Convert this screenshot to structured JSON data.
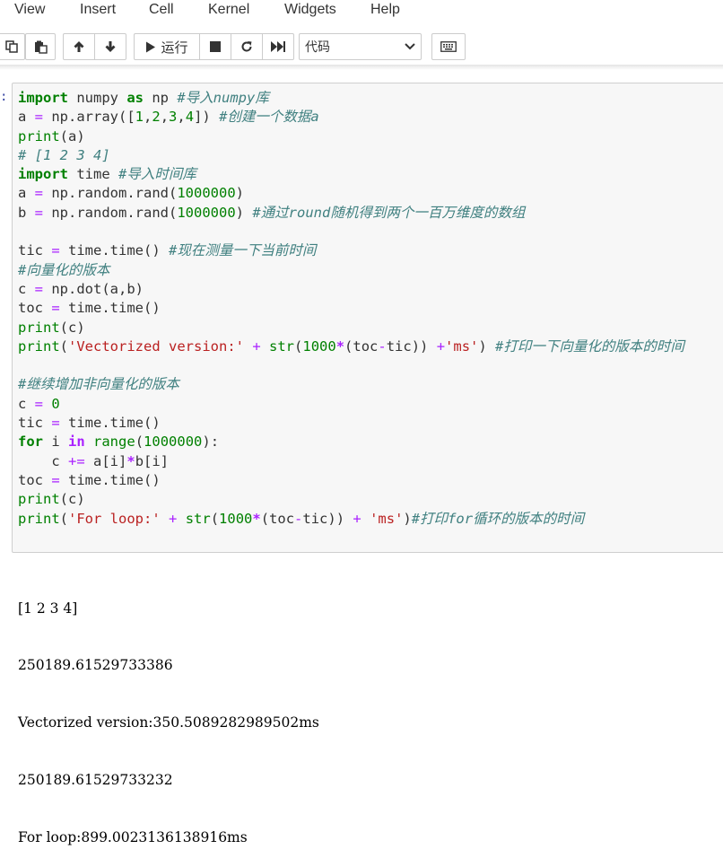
{
  "menubar": {
    "items": [
      "View",
      "Insert",
      "Cell",
      "Kernel",
      "Widgets",
      "Help"
    ]
  },
  "toolbar": {
    "run_label": "运行",
    "cell_type": "代码",
    "icons": [
      "copy-icon",
      "paste-icon",
      "move-up-icon",
      "move-down-icon",
      "run-icon",
      "stop-icon",
      "restart-icon",
      "fast-forward-icon",
      "keyboard-icon"
    ]
  },
  "cell": {
    "prompt": ":",
    "code_lines": [
      [
        [
          "kw",
          "import"
        ],
        [
          "t",
          " numpy "
        ],
        [
          "kw",
          "as"
        ],
        [
          "t",
          " np "
        ],
        [
          "cm",
          "#导入numpy库"
        ]
      ],
      [
        [
          "t",
          "a "
        ],
        [
          "op",
          "="
        ],
        [
          "t",
          " np.array(["
        ],
        [
          "num",
          "1"
        ],
        [
          "t",
          ","
        ],
        [
          "num",
          "2"
        ],
        [
          "t",
          ","
        ],
        [
          "num",
          "3"
        ],
        [
          "t",
          ","
        ],
        [
          "num",
          "4"
        ],
        [
          "t",
          "]) "
        ],
        [
          "cm",
          "#创建一个数据a"
        ]
      ],
      [
        [
          "bi",
          "print"
        ],
        [
          "t",
          "(a)"
        ]
      ],
      [
        [
          "cm",
          "# [1 2 3 4]"
        ]
      ],
      [
        [
          "kw",
          "import"
        ],
        [
          "t",
          " time "
        ],
        [
          "cm",
          "#导入时间库"
        ]
      ],
      [
        [
          "t",
          "a "
        ],
        [
          "op",
          "="
        ],
        [
          "t",
          " np.random.rand("
        ],
        [
          "num",
          "1000000"
        ],
        [
          "t",
          ")"
        ]
      ],
      [
        [
          "t",
          "b "
        ],
        [
          "op",
          "="
        ],
        [
          "t",
          " np.random.rand("
        ],
        [
          "num",
          "1000000"
        ],
        [
          "t",
          ") "
        ],
        [
          "cm",
          "#通过round随机得到两个一百万维度的数组"
        ]
      ],
      [],
      [
        [
          "t",
          "tic "
        ],
        [
          "op",
          "="
        ],
        [
          "t",
          " time.time() "
        ],
        [
          "cm",
          "#现在测量一下当前时间"
        ]
      ],
      [
        [
          "cm",
          "#向量化的版本"
        ]
      ],
      [
        [
          "t",
          "c "
        ],
        [
          "op",
          "="
        ],
        [
          "t",
          " np.dot(a,b)"
        ]
      ],
      [
        [
          "t",
          "toc "
        ],
        [
          "op",
          "="
        ],
        [
          "t",
          " time.time()"
        ]
      ],
      [
        [
          "bi",
          "print"
        ],
        [
          "t",
          "(c)"
        ]
      ],
      [
        [
          "bi",
          "print"
        ],
        [
          "t",
          "("
        ],
        [
          "str",
          "'Vectorized version:'"
        ],
        [
          "t",
          " "
        ],
        [
          "op",
          "+"
        ],
        [
          "t",
          " "
        ],
        [
          "bi",
          "str"
        ],
        [
          "t",
          "("
        ],
        [
          "num",
          "1000"
        ],
        [
          "opk",
          "*"
        ],
        [
          "t",
          "(toc"
        ],
        [
          "op",
          "-"
        ],
        [
          "t",
          "tic)) "
        ],
        [
          "op",
          "+"
        ],
        [
          "str",
          "'ms'"
        ],
        [
          "t",
          ") "
        ],
        [
          "cm",
          "#打印一下向量化的版本的时间"
        ]
      ],
      [],
      [
        [
          "cm",
          "#继续增加非向量化的版本"
        ]
      ],
      [
        [
          "t",
          "c "
        ],
        [
          "op",
          "="
        ],
        [
          "t",
          " "
        ],
        [
          "num",
          "0"
        ]
      ],
      [
        [
          "t",
          "tic "
        ],
        [
          "op",
          "="
        ],
        [
          "t",
          " time.time()"
        ]
      ],
      [
        [
          "kw",
          "for"
        ],
        [
          "t",
          " i "
        ],
        [
          "opk",
          "in"
        ],
        [
          "t",
          " "
        ],
        [
          "bi",
          "range"
        ],
        [
          "t",
          "("
        ],
        [
          "num",
          "1000000"
        ],
        [
          "t",
          "):"
        ]
      ],
      [
        [
          "t",
          "    c "
        ],
        [
          "op",
          "+="
        ],
        [
          "t",
          " a[i]"
        ],
        [
          "opk",
          "*"
        ],
        [
          "t",
          "b[i]"
        ]
      ],
      [
        [
          "t",
          "toc "
        ],
        [
          "op",
          "="
        ],
        [
          "t",
          " time.time()"
        ]
      ],
      [
        [
          "bi",
          "print"
        ],
        [
          "t",
          "(c)"
        ]
      ],
      [
        [
          "bi",
          "print"
        ],
        [
          "t",
          "("
        ],
        [
          "str",
          "'For loop:'"
        ],
        [
          "t",
          " "
        ],
        [
          "op",
          "+"
        ],
        [
          "t",
          " "
        ],
        [
          "bi",
          "str"
        ],
        [
          "t",
          "("
        ],
        [
          "num",
          "1000"
        ],
        [
          "opk",
          "*"
        ],
        [
          "t",
          "(toc"
        ],
        [
          "op",
          "-"
        ],
        [
          "t",
          "tic)) "
        ],
        [
          "op",
          "+"
        ],
        [
          "t",
          " "
        ],
        [
          "str",
          "'ms'"
        ],
        [
          "t",
          ")"
        ],
        [
          "cm",
          "#打印for循环的版本的时间"
        ]
      ]
    ],
    "output_lines": [
      "[1 2 3 4]",
      "250189.61529733386",
      "Vectorized version:350.5089282989502ms",
      "250189.61529733232",
      "For loop:899.0023136138916ms"
    ]
  }
}
